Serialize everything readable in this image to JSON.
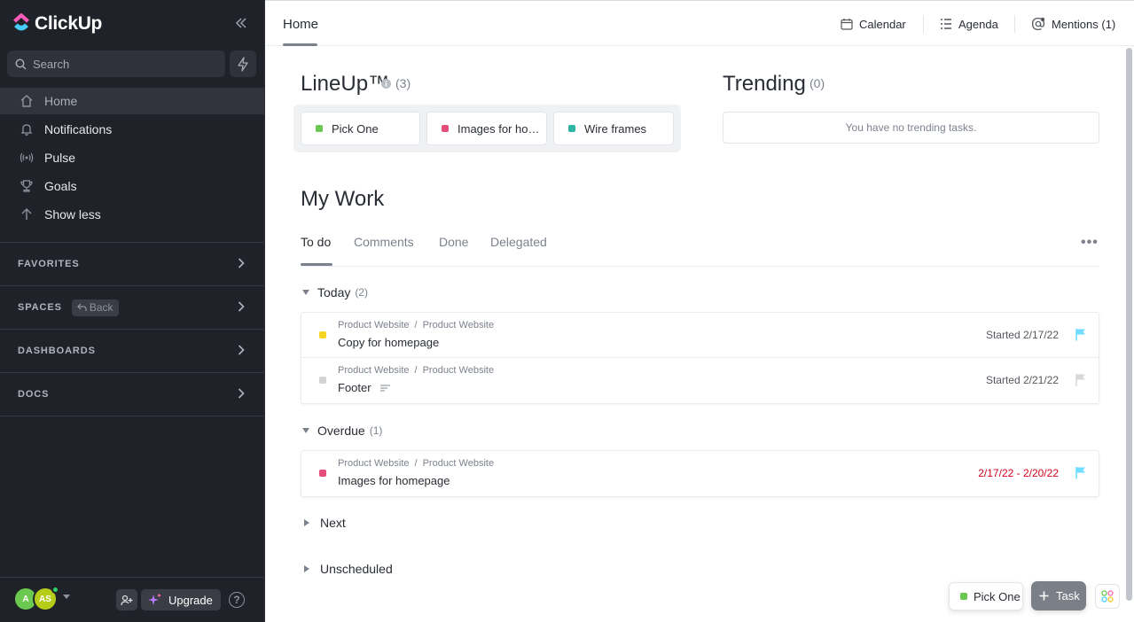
{
  "app": {
    "logo_text": "ClickUp",
    "accent_color": "#7b68ee"
  },
  "sidebar": {
    "search": {
      "placeholder": "Search"
    },
    "nav": [
      {
        "label": "Home",
        "icon": "home-icon",
        "active": true
      },
      {
        "label": "Notifications",
        "icon": "bell-icon"
      },
      {
        "label": "Pulse",
        "icon": "pulse-icon"
      },
      {
        "label": "Goals",
        "icon": "trophy-icon"
      },
      {
        "label": "Show less",
        "icon": "arrow-up-icon"
      }
    ],
    "sections": [
      {
        "label": "FAVORITES"
      },
      {
        "label": "SPACES",
        "back_label": "Back"
      },
      {
        "label": "DASHBOARDS"
      },
      {
        "label": "DOCS"
      }
    ],
    "footer": {
      "avatars": [
        {
          "initials": "A",
          "color": "#6bc950"
        },
        {
          "initials": "AS",
          "color": "#b5cc18"
        }
      ],
      "upgrade_label": "Upgrade",
      "help_label": "?"
    }
  },
  "header": {
    "tab": "Home",
    "actions": [
      {
        "label": "Calendar",
        "icon": "calendar-icon"
      },
      {
        "label": "Agenda",
        "icon": "agenda-icon"
      },
      {
        "label": "Mentions (1)",
        "icon": "mention-icon"
      }
    ]
  },
  "lineup": {
    "title": "LineUp™",
    "count": "(3)",
    "cards": [
      {
        "label": "Pick One",
        "color": "#6bc950"
      },
      {
        "label": "Images for homepage",
        "color": "#e44e7b"
      },
      {
        "label": "Wire frames",
        "color": "#2db5a3"
      }
    ]
  },
  "trending": {
    "title": "Trending",
    "count": "(0)",
    "empty_text": "You have no trending tasks."
  },
  "my_work": {
    "title": "My Work",
    "tabs": [
      "To do",
      "Comments",
      "Done",
      "Delegated"
    ],
    "more_label": "•••",
    "groups": [
      {
        "title": "Today",
        "count": "(2)",
        "tasks": [
          {
            "space": "Product Website",
            "list": "Product Website",
            "name": "Copy for homepage",
            "date": "Started 2/17/22",
            "status_color": "#f8d422",
            "flag_color": "#6fddff",
            "overdue": false
          },
          {
            "space": "Product Website",
            "list": "Product Website",
            "name": "Footer",
            "date": "Started 2/21/22",
            "status_color": "#d3d3d3",
            "flag_color": "#d8d8d8",
            "overdue": false
          }
        ]
      },
      {
        "title": "Overdue",
        "count": "(1)",
        "tasks": [
          {
            "space": "Product Website",
            "list": "Product Website",
            "name": "Images for homepage",
            "date": "2/17/22 - 2/20/22",
            "status_color": "#e44e7b",
            "flag_color": "#6fddff",
            "overdue": true
          }
        ]
      }
    ],
    "collapsed_groups": [
      "Next",
      "Unscheduled"
    ]
  },
  "tray": {
    "pinned_task": "Pick One",
    "pinned_color": "#6bc950",
    "task_button": "Task"
  }
}
